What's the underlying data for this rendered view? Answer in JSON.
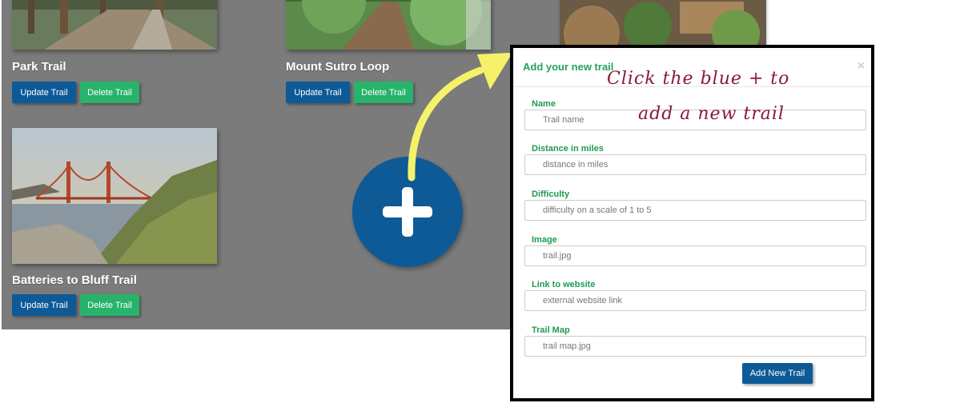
{
  "cards": [
    {
      "title": "Park Trail",
      "update_label": "Update Trail",
      "delete_label": "Delete Trail"
    },
    {
      "title": "Mount Sutro Loop",
      "update_label": "Update Trail",
      "delete_label": "Delete Trail"
    },
    {
      "title": "Batteries to Bluff Trail",
      "update_label": "Update Trail",
      "delete_label": "Delete Trail"
    }
  ],
  "modal": {
    "title": "Add your new trail",
    "close_label": "×",
    "fields": [
      {
        "label": "Name",
        "placeholder": "Trail name"
      },
      {
        "label": "Distance in miles",
        "placeholder": "distance in miles"
      },
      {
        "label": "Difficulty",
        "placeholder": "difficulty on a scale of 1 to 5"
      },
      {
        "label": "Image",
        "placeholder": "trail.jpg"
      },
      {
        "label": "Link to website",
        "placeholder": "external website link"
      },
      {
        "label": "Trail Map",
        "placeholder": "trail map.jpg"
      }
    ],
    "submit_label": "Add New Trail"
  },
  "annotation": {
    "line1": "Click the blue + to",
    "line2": "add a new trail"
  },
  "colors": {
    "backdrop": "#7b7b7b",
    "primary_blue": "#0e5a97",
    "green": "#27b36a",
    "arrow_yellow": "#f5f26a",
    "handwriting": "#8b1a3a"
  },
  "icons": {
    "fab": "plus-icon",
    "close": "close-icon"
  }
}
